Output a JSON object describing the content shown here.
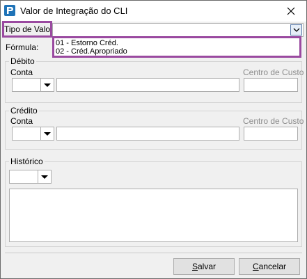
{
  "window": {
    "title": "Valor de Integração do CLI"
  },
  "form": {
    "tipo_valor_label": "Tipo de Valor:",
    "tipo_valor_value": "",
    "formula_label": "Fórmula:",
    "tipo_valor_options": [
      "01 - Estorno Créd.",
      "02 - Créd.Apropriado"
    ]
  },
  "debito": {
    "group_label": "Débito",
    "conta_label": "Conta",
    "centro_custo_label": "Centro de Custo",
    "conta_value": "",
    "centro_custo_value": ""
  },
  "credito": {
    "group_label": "Crédito",
    "conta_label": "Conta",
    "centro_custo_label": "Centro de Custo",
    "conta_value": "",
    "centro_custo_value": ""
  },
  "historico": {
    "group_label": "Histórico",
    "text": ""
  },
  "buttons": {
    "salvar_prefix": "",
    "salvar_hotkey": "S",
    "salvar_rest": "alvar",
    "cancelar_hotkey": "C",
    "cancelar_rest": "ancelar"
  },
  "colors": {
    "highlight": "#9a4aa0",
    "app_icon": "#1f73b7"
  }
}
